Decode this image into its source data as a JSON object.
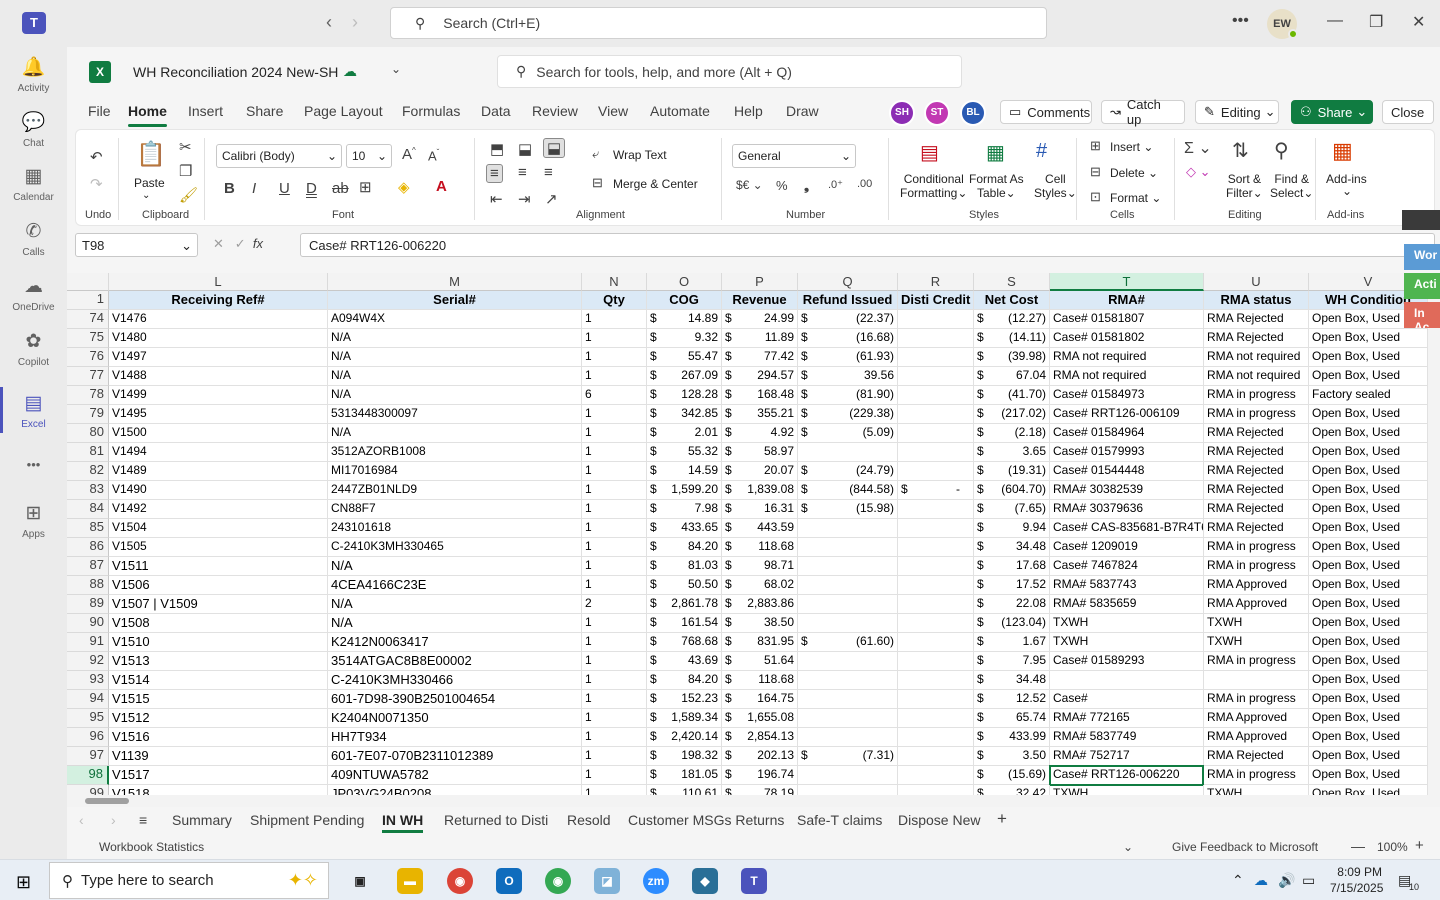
{
  "teams": {
    "search_placeholder": "Search (Ctrl+E)",
    "avatar": "EW"
  },
  "rail": [
    {
      "label": "Activity",
      "icon": "bell-icon",
      "glyph": "🔔"
    },
    {
      "label": "Chat",
      "icon": "chat-icon",
      "glyph": "💬"
    },
    {
      "label": "Calendar",
      "icon": "calendar-icon",
      "glyph": "▦"
    },
    {
      "label": "Calls",
      "icon": "phone-icon",
      "glyph": "✆"
    },
    {
      "label": "OneDrive",
      "icon": "cloud-icon",
      "glyph": "☁"
    },
    {
      "label": "Copilot",
      "icon": "copilot-icon",
      "glyph": "✿"
    },
    {
      "label": "Excel",
      "icon": "excel-icon",
      "glyph": "▤"
    },
    {
      "label": "",
      "icon": "more-icon",
      "glyph": "•••"
    },
    {
      "label": "Apps",
      "icon": "add-apps-icon",
      "glyph": "⊞"
    }
  ],
  "workbook": {
    "title": "WH Reconciliation 2024 New-SH",
    "search_placeholder": "Search for tools, help, and more (Alt + Q)"
  },
  "menu": [
    "File",
    "Home",
    "Insert",
    "Share",
    "Page Layout",
    "Formulas",
    "Data",
    "Review",
    "View",
    "Automate",
    "Help",
    "Draw"
  ],
  "presence": [
    {
      "initials": "SH",
      "color": "#8c2db4"
    },
    {
      "initials": "ST",
      "color": "#c239b3"
    },
    {
      "initials": "BL",
      "color": "#2a5ab3"
    }
  ],
  "header_buttons": {
    "comments": "Comments",
    "catchup": "Catch up",
    "editing": "Editing",
    "share": "Share",
    "close": "Close"
  },
  "ribbon": {
    "undo": "Undo",
    "clipboard": "Clipboard",
    "paste": "Paste",
    "font_name": "Calibri (Body)",
    "font_size": "10",
    "font": "Font",
    "wrap_text": "Wrap Text",
    "merge_center": "Merge & Center",
    "alignment": "Alignment",
    "number_format": "General",
    "number": "Number",
    "conditional": "Conditional",
    "formatting": "Formatting",
    "format_as": "Format As",
    "table": "Table",
    "cell": "Cell",
    "styles_btn": "Styles",
    "styles": "Styles",
    "insert": "Insert",
    "delete": "Delete",
    "format": "Format",
    "cells": "Cells",
    "sort": "Sort &",
    "filter": "Filter",
    "find": "Find &",
    "select": "Select",
    "editing": "Editing",
    "addins": "Add-ins",
    "addins_group": "Add-ins"
  },
  "formula_bar": {
    "name_box": "T98",
    "formula": "Case# RRT126-006220"
  },
  "columns": [
    {
      "letter": "L",
      "header": "Receiving Ref#"
    },
    {
      "letter": "M",
      "header": "Serial#"
    },
    {
      "letter": "N",
      "header": "Qty"
    },
    {
      "letter": "O",
      "header": "COG"
    },
    {
      "letter": "P",
      "header": "Revenue"
    },
    {
      "letter": "Q",
      "header": "Refund Issued"
    },
    {
      "letter": "R",
      "header": "Disti Credit"
    },
    {
      "letter": "S",
      "header": "Net Cost"
    },
    {
      "letter": "T",
      "header": "RMA#"
    },
    {
      "letter": "U",
      "header": "RMA status"
    },
    {
      "letter": "V",
      "header": "WH Condition"
    }
  ],
  "header_row_num": "1",
  "rows": [
    [
      "74",
      "V1476",
      "A094W4X",
      "1",
      "14.89",
      "24.99",
      "(22.37)",
      "",
      "(12.27)",
      "Case# 01581807",
      "RMA Rejected",
      "Open Box, Used"
    ],
    [
      "75",
      "V1480",
      "N/A",
      "1",
      "9.32",
      "11.89",
      "(16.68)",
      "",
      "(14.11)",
      "Case# 01581802",
      "RMA Rejected",
      "Open Box, Used"
    ],
    [
      "76",
      "V1497",
      "N/A",
      "1",
      "55.47",
      "77.42",
      "(61.93)",
      "",
      "(39.98)",
      "RMA not required",
      "RMA not required",
      "Open Box, Used"
    ],
    [
      "77",
      "V1488",
      "N/A",
      "1",
      "267.09",
      "294.57",
      "39.56",
      "",
      "67.04",
      "RMA not required",
      "RMA not required",
      "Open Box, Used"
    ],
    [
      "78",
      "V1499",
      "N/A",
      "6",
      "128.28",
      "168.48",
      "(81.90)",
      "",
      "(41.70)",
      "Case# 01584973",
      "RMA in progress",
      "Factory sealed"
    ],
    [
      "79",
      "V1495",
      "5313448300097",
      "1",
      "342.85",
      "355.21",
      "(229.38)",
      "",
      "(217.02)",
      "Case# RRT126-006109",
      "RMA in progress",
      "Open Box, Used"
    ],
    [
      "80",
      "V1500",
      "N/A",
      "1",
      "2.01",
      "4.92",
      "(5.09)",
      "",
      "(2.18)",
      "Case# 01584964",
      "RMA Rejected",
      "Open Box, Used"
    ],
    [
      "81",
      "V1494",
      "3512AZORB1008",
      "1",
      "55.32",
      "58.97",
      "",
      "",
      "3.65",
      "Case# 01579993",
      "RMA Rejected",
      "Open Box, Used"
    ],
    [
      "82",
      "V1489",
      "MI17016984",
      "1",
      "14.59",
      "20.07",
      "(24.79)",
      "",
      "(19.31)",
      "Case# 01544448",
      "RMA Rejected",
      "Open Box, Used"
    ],
    [
      "83",
      "V1490",
      "2447ZB01NLD9",
      "1",
      "1,599.20",
      "1,839.08",
      "(844.58)",
      "-",
      "(604.70)",
      "RMA# 30382539",
      "RMA Rejected",
      "Open Box, Used"
    ],
    [
      "84",
      "V1492",
      "CN88F7",
      "1",
      "7.98",
      "16.31",
      "(15.98)",
      "",
      "(7.65)",
      "RMA# 30379636",
      "RMA Rejected",
      "Open Box, Used"
    ],
    [
      "85",
      "V1504",
      "243101618",
      "1",
      "433.65",
      "443.59",
      "",
      "",
      "9.94",
      "Case# CAS-835681-B7R4T6-1",
      "RMA Rejected",
      "Open Box, Used"
    ],
    [
      "86",
      "V1505",
      "C-2410K3MH330465",
      "1",
      "84.20",
      "118.68",
      "",
      "",
      "34.48",
      "Case# 1209019",
      "RMA in progress",
      "Open Box, Used"
    ],
    [
      "87",
      "V1511",
      "N/A",
      "1",
      "81.03",
      "98.71",
      "",
      "",
      "17.68",
      "Case# 7467824",
      "RMA in progress",
      "Open Box, Used"
    ],
    [
      "88",
      "V1506",
      "4CEA4166C23E",
      "1",
      "50.50",
      "68.02",
      "",
      "",
      "17.52",
      "RMA# 5837743",
      "RMA Approved",
      "Open Box, Used"
    ],
    [
      "89",
      "V1507 | V1509",
      "N/A",
      "2",
      "2,861.78",
      "2,883.86",
      "",
      "",
      "22.08",
      "RMA# 5835659",
      "RMA Approved",
      "Open Box, Used"
    ],
    [
      "90",
      "V1508",
      "N/A",
      "1",
      "161.54",
      "38.50",
      "",
      "",
      "(123.04)",
      "TXWH",
      "TXWH",
      "Open Box, Used"
    ],
    [
      "91",
      "V1510",
      "K2412N0063417",
      "1",
      "768.68",
      "831.95",
      "(61.60)",
      "",
      "1.67",
      "TXWH",
      "TXWH",
      "Open Box, Used"
    ],
    [
      "92",
      "V1513",
      "3514ATGAC8B8E00002",
      "1",
      "43.69",
      "51.64",
      "",
      "",
      "7.95",
      "Case# 01589293",
      "RMA in progress",
      "Open Box, Used"
    ],
    [
      "93",
      "V1514",
      "C-2410K3MH330466",
      "1",
      "84.20",
      "118.68",
      "",
      "",
      "34.48",
      "",
      "",
      "Open Box, Used"
    ],
    [
      "94",
      "V1515",
      "601-7D98-390B2501004654",
      "1",
      "152.23",
      "164.75",
      "",
      "",
      "12.52",
      "Case#",
      "RMA in progress",
      "Open Box, Used"
    ],
    [
      "95",
      "V1512",
      "K2404N0071350",
      "1",
      "1,589.34",
      "1,655.08",
      "",
      "",
      "65.74",
      "RMA# 772165",
      "RMA Approved",
      "Open Box, Used"
    ],
    [
      "96",
      "V1516",
      "HH7T934",
      "1",
      "2,420.14",
      "2,854.13",
      "",
      "",
      "433.99",
      "RMA# 5837749",
      "RMA Approved",
      "Open Box, Used"
    ],
    [
      "97",
      "V1139",
      "601-7E07-070B2311012389",
      "1",
      "198.32",
      "202.13",
      "(7.31)",
      "",
      "3.50",
      "RMA# 752717",
      "RMA Rejected",
      "Open Box, Used"
    ],
    [
      "98",
      "V1517",
      "409NTUWA5782",
      "1",
      "181.05",
      "196.74",
      "",
      "",
      "(15.69)",
      "Case# RRT126-006220",
      "RMA in progress",
      "Open Box, Used"
    ],
    [
      "99",
      "V1518",
      "JP03VG24B0208",
      "1",
      "110.61",
      "78.19",
      "",
      "",
      "32.42",
      "TXWH",
      "TXWH",
      "Open Box, Used"
    ]
  ],
  "currency_symbol": "$",
  "sheets": [
    "Summary",
    "Shipment Pending",
    "IN WH",
    "Returned to Disti",
    "Resold",
    "Customer MSGs Returns",
    "Safe-T claims",
    "Dispose New"
  ],
  "active_sheet": "IN WH",
  "status": {
    "left": "Workbook Statistics",
    "feedback": "Give Feedback to Microsoft",
    "zoom": "100%"
  },
  "side_panel": [
    "Wor",
    "Acti",
    "In Ac"
  ],
  "taskbar": {
    "search": "Type here to search",
    "time": "8:09 PM",
    "date": "7/15/2025",
    "notif": "10"
  }
}
